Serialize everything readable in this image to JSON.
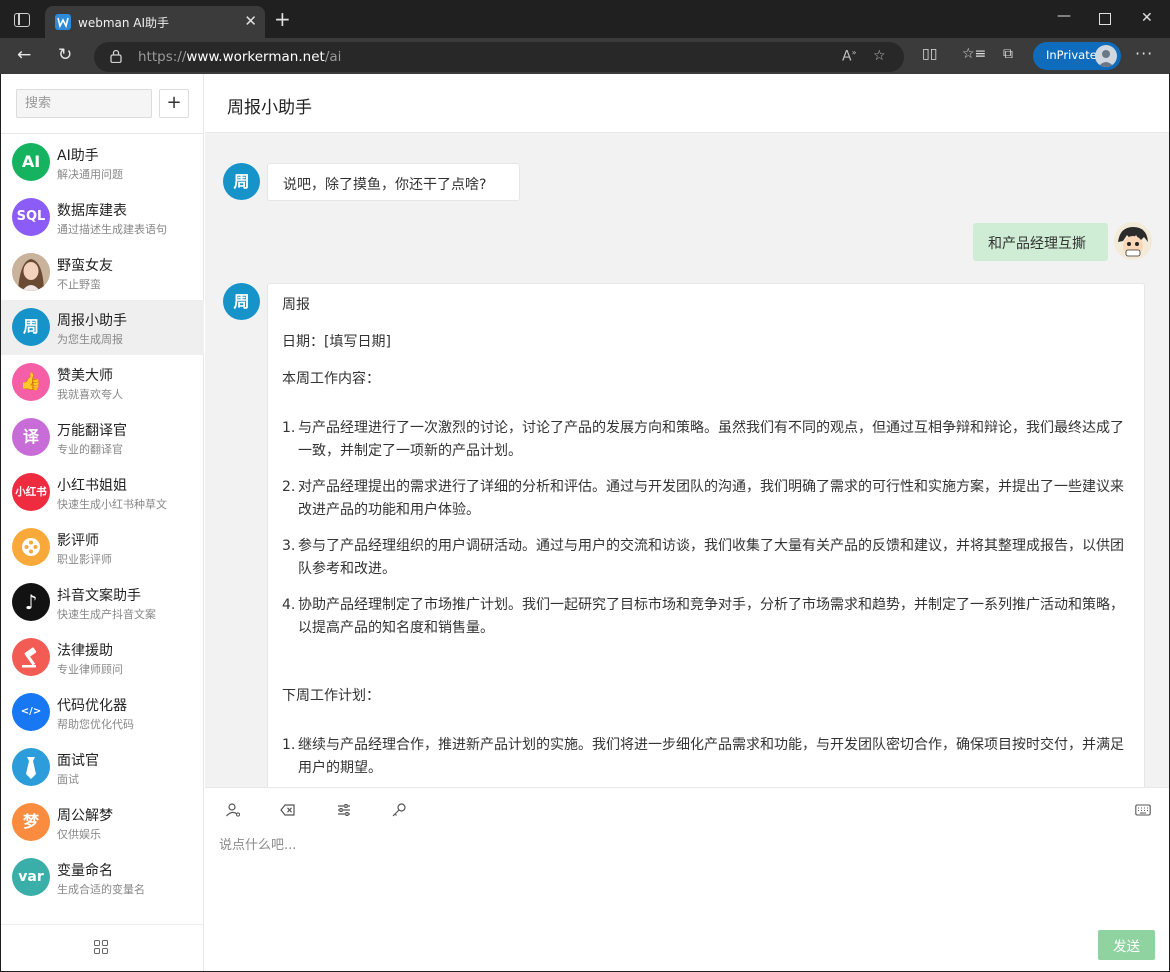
{
  "browser": {
    "tab_title": "webman AI助手",
    "url_scheme": "https://",
    "url_host": "www.workerman.net",
    "url_path": "/ai",
    "inprivate_label": "InPrivate"
  },
  "sidebar": {
    "search_placeholder": "搜索",
    "add_label": "+",
    "contacts": [
      {
        "name": "AI助手",
        "desc": "解决通用问题",
        "badge": "AI",
        "color": "#15b35f"
      },
      {
        "name": "数据库建表",
        "desc": "通过描述生成建表语句",
        "badge": "SQL",
        "color": "#8b5cf6"
      },
      {
        "name": "野蛮女友",
        "desc": "不止野蛮",
        "badge": "",
        "color": "#d6b08e"
      },
      {
        "name": "周报小助手",
        "desc": "为您生成周报",
        "badge": "周",
        "color": "#1693c9"
      },
      {
        "name": "赞美大师",
        "desc": "我就喜欢夸人",
        "badge": "👍",
        "color": "#f55fa5"
      },
      {
        "name": "万能翻译官",
        "desc": "专业的翻译官",
        "badge": "译",
        "color": "#c86dd7"
      },
      {
        "name": "小红书姐姐",
        "desc": "快速生成小红书种草文",
        "badge": "小红书",
        "color": "#ef2b3f"
      },
      {
        "name": "影评师",
        "desc": "职业影评师",
        "badge": "",
        "color": "#f8a93a"
      },
      {
        "name": "抖音文案助手",
        "desc": "快速生成产抖音文案",
        "badge": "♪",
        "color": "#121212"
      },
      {
        "name": "法律援助",
        "desc": "专业律师顾问",
        "badge": "",
        "color": "#f25c54"
      },
      {
        "name": "代码优化器",
        "desc": "帮助您优化代码",
        "badge": "</>",
        "color": "#1877f2"
      },
      {
        "name": "面试官",
        "desc": "面试",
        "badge": "",
        "color": "#2d9cdb"
      },
      {
        "name": "周公解梦",
        "desc": "仅供娱乐",
        "badge": "梦",
        "color": "#f98c3f"
      },
      {
        "name": "变量命名",
        "desc": "生成合适的变量名",
        "badge": "var",
        "color": "#3aafa9"
      }
    ]
  },
  "chat": {
    "title": "周报小助手",
    "bot_badge": "周",
    "msg1": "说吧，除了摸鱼，你还干了点啥?",
    "mine": "和产品经理互撕",
    "reply": {
      "p1": "周报",
      "p2": "日期：[填写日期]",
      "p3": "本周工作内容：",
      "items1": [
        "与产品经理进行了一次激烈的讨论，讨论了产品的发展方向和策略。虽然我们有不同的观点，但通过互相争辩和辩论，我们最终达成了一致，并制定了一项新的产品计划。",
        "对产品经理提出的需求进行了详细的分析和评估。通过与开发团队的沟通，我们明确了需求的可行性和实施方案，并提出了一些建议来改进产品的功能和用户体验。",
        "参与了产品经理组织的用户调研活动。通过与用户的交流和访谈，我们收集了大量有关产品的反馈和建议，并将其整理成报告，以供团队参考和改进。",
        "协助产品经理制定了市场推广计划。我们一起研究了目标市场和竞争对手，分析了市场需求和趋势，并制定了一系列推广活动和策略，以提高产品的知名度和销售量。"
      ],
      "p4": "下周工作计划：",
      "items2": [
        "继续与产品经理合作，推进新产品计划的实施。我们将进一步细化产品需求和功能，与开发团队密切合作，确保项目按时交付，并满足用户的期望。"
      ]
    }
  },
  "composer": {
    "placeholder": "说点什么吧...",
    "send_label": "发送"
  }
}
